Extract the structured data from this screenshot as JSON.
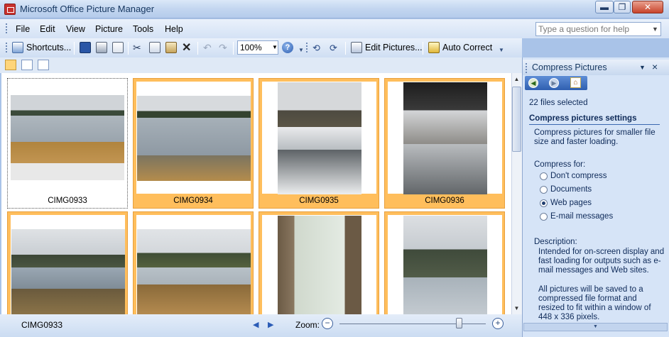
{
  "window": {
    "title": "Microsoft Office Picture Manager",
    "minimize": "▬",
    "restore": "❐",
    "close": "✕"
  },
  "menu": {
    "items": [
      "File",
      "Edit",
      "View",
      "Picture",
      "Tools",
      "Help"
    ],
    "help_placeholder": "Type a question for help"
  },
  "toolbar": {
    "shortcuts_label": "Shortcuts...",
    "zoom_value": "100%",
    "edit_pictures_label": "Edit Pictures...",
    "auto_correct_label": "Auto Correct"
  },
  "thumbnails": [
    {
      "caption": "CIMG0933",
      "icon": "frozen-lake-photo",
      "selected": true
    },
    {
      "caption": "CIMG0934",
      "icon": "frozen-lake-photo",
      "selected": true
    },
    {
      "caption": "CIMG0935",
      "icon": "snowy-path-photo",
      "selected": true
    },
    {
      "caption": "CIMG0936",
      "icon": "bridge-underside-photo",
      "selected": true
    },
    {
      "caption": "",
      "icon": "river-photo",
      "selected": true
    },
    {
      "caption": "",
      "icon": "marsh-photo",
      "selected": true
    },
    {
      "caption": "",
      "icon": "stop-closed-sign-photo",
      "selected": true
    },
    {
      "caption": "",
      "icon": "river-trees-photo",
      "selected": true
    }
  ],
  "status": {
    "file_name": "CIMG0933",
    "zoom_label": "Zoom:",
    "zoom_out": "−",
    "zoom_in": "+"
  },
  "pane": {
    "title": "Compress Pictures",
    "files_selected": "22 files selected",
    "section_title": "Compress pictures settings",
    "intro": "Compress pictures for smaller file size and faster loading.",
    "compress_for_label": "Compress for:",
    "options": [
      {
        "label": "Don't compress",
        "checked": false
      },
      {
        "label": "Documents",
        "checked": false
      },
      {
        "label": "Web pages",
        "checked": true
      },
      {
        "label": "E-mail messages",
        "checked": false
      }
    ],
    "description_label": "Description:",
    "description": "Intended for on-screen display and fast loading for outputs such as e-mail messages and Web sites.",
    "note": "All pictures will be saved to a compressed file format and resized to fit within a window of 448 x 336 pixels."
  },
  "colors": {
    "selection": "#ffbe5c",
    "pane_bg": "#d6e4f7",
    "accent": "#0e2a59"
  }
}
